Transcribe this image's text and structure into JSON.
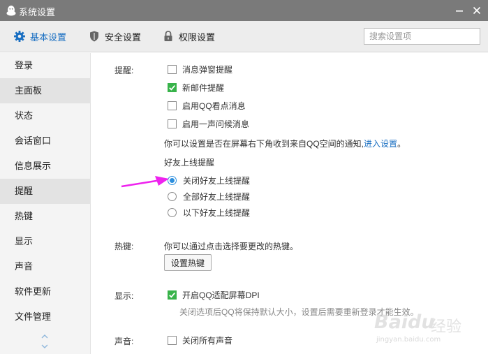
{
  "window": {
    "title": "系统设置"
  },
  "tabs": [
    {
      "label": "基本设置",
      "icon": "gear-icon",
      "active": true
    },
    {
      "label": "安全设置",
      "icon": "shield-icon",
      "active": false
    },
    {
      "label": "权限设置",
      "icon": "lock-icon",
      "active": false
    }
  ],
  "search": {
    "placeholder": "搜索设置项",
    "value": ""
  },
  "sidebar": {
    "items": [
      {
        "label": "登录"
      },
      {
        "label": "主面板",
        "selected": true
      },
      {
        "label": "状态"
      },
      {
        "label": "会话窗口"
      },
      {
        "label": "信息展示"
      },
      {
        "label": "提醒",
        "selected": true
      },
      {
        "label": "热键"
      },
      {
        "label": "显示"
      },
      {
        "label": "声音"
      },
      {
        "label": "软件更新"
      },
      {
        "label": "文件管理"
      }
    ]
  },
  "reminders": {
    "label": "提醒:",
    "options": [
      {
        "label": "消息弹窗提醒",
        "checked": false
      },
      {
        "label": "新邮件提醒",
        "checked": true
      },
      {
        "label": "启用QQ看点消息",
        "checked": false
      },
      {
        "label": "启用一声问候消息",
        "checked": false
      }
    ],
    "notice_text": "你可以设置是否在屏幕右下角收到来自QQ空间的通知,",
    "notice_link": "进入设置",
    "notice_end": "。",
    "friend_online": {
      "title": "好友上线提醒",
      "options": [
        {
          "label": "关闭好友上线提醒",
          "selected": true
        },
        {
          "label": "全部好友上线提醒",
          "selected": false
        },
        {
          "label": "以下好友上线提醒",
          "selected": false
        }
      ]
    }
  },
  "hotkeys": {
    "label": "热键:",
    "description": "你可以通过点击选择要更改的热键。",
    "button_label": "设置热键"
  },
  "display": {
    "label": "显示:",
    "option": {
      "label": "开启QQ适配屏幕DPI",
      "checked": true
    },
    "hint": "关闭选项后QQ将保持默认大小，设置后需要重新登录才能生效。"
  },
  "sound": {
    "label": "声音:",
    "option": {
      "label": "关闭所有声音",
      "checked": false
    }
  },
  "watermark": {
    "brand": "Baidu",
    "brand_cn": "经验",
    "url": "jingyan.baidu.com"
  },
  "colors": {
    "accent": "#1a6fc2",
    "check_green": "#38b34a",
    "arrow_magenta": "#ee22ee",
    "titlebar": "#7a7a7a"
  }
}
